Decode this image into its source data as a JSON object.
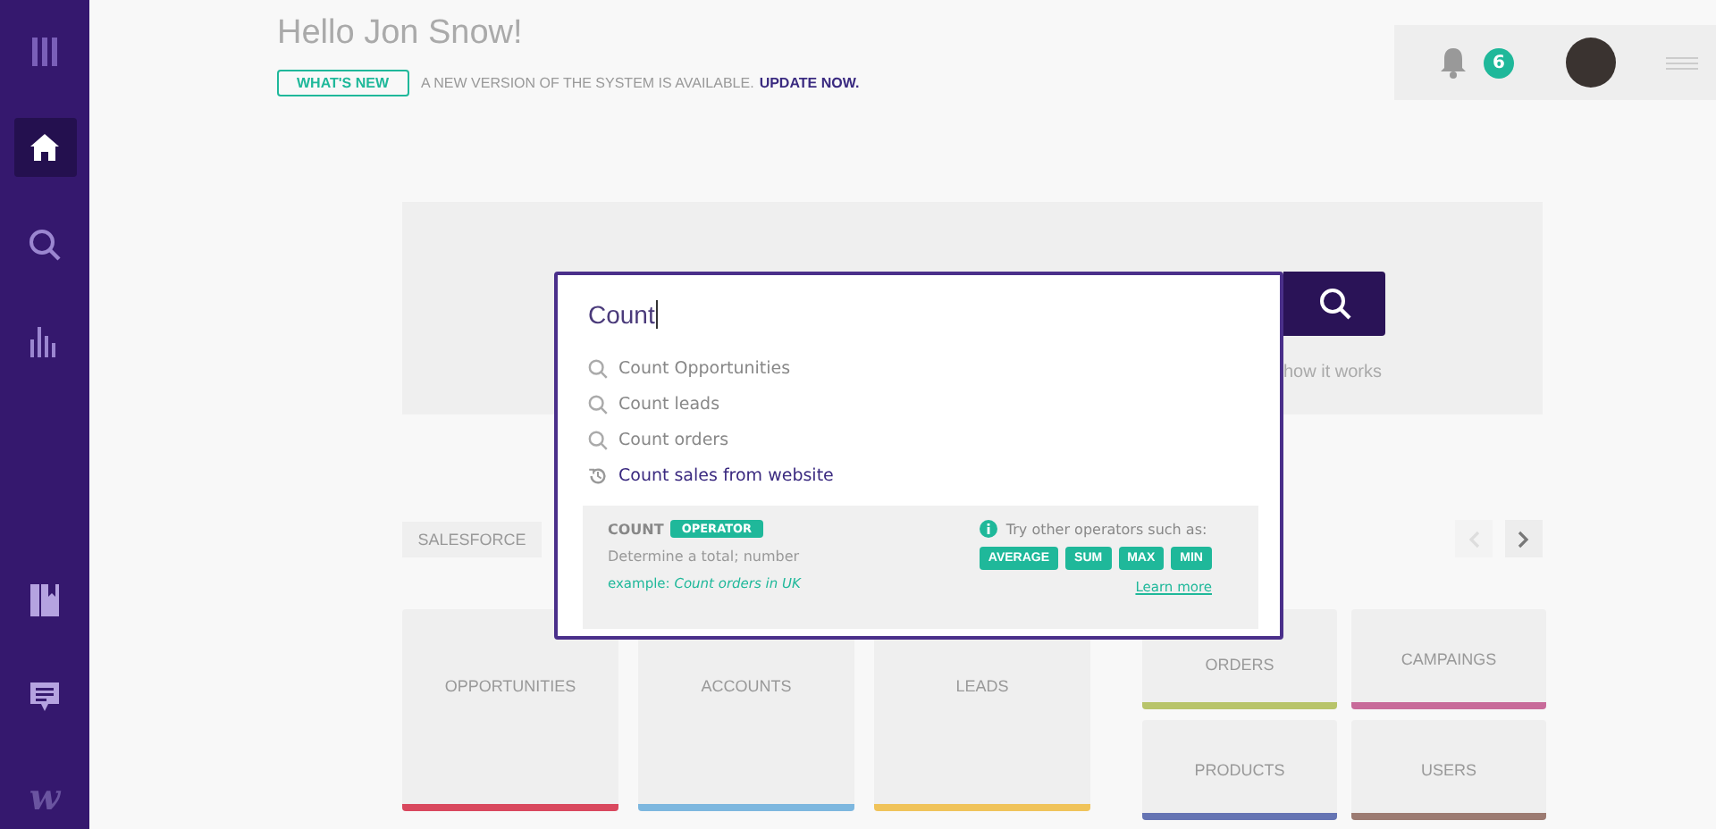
{
  "sidebar": {
    "items": [
      {
        "kind": "menu",
        "selected": false
      },
      {
        "kind": "home",
        "selected": true
      },
      {
        "kind": "search",
        "selected": false
      },
      {
        "kind": "chart",
        "selected": false
      },
      {
        "kind": "book",
        "selected": false
      },
      {
        "kind": "chat",
        "selected": false
      }
    ],
    "logo": "w"
  },
  "greeting": "Hello Jon Snow!",
  "announcement": {
    "badge": "WHAT'S NEW",
    "text": "A NEW VERSION OF THE SYSTEM IS AVAILABLE.",
    "link": "UPDATE NOW."
  },
  "topbar": {
    "notifications": "6"
  },
  "search": {
    "value": "Count",
    "help": "how it works",
    "suggestions": [
      {
        "text": "Count Opportunities",
        "kind": "search"
      },
      {
        "text": "Count leads",
        "kind": "search"
      },
      {
        "text": "Count orders",
        "kind": "search"
      },
      {
        "text": "Count sales from website",
        "kind": "history"
      }
    ],
    "operator": {
      "name": "COUNT",
      "tag": "OPERATOR",
      "description": "Determine a total; number",
      "example": "example: *Count orders in UK*",
      "hint": "Try other operators such as:",
      "operators": [
        "AVERAGE",
        "SUM",
        "MAX",
        "MIN"
      ],
      "learn_more": "Learn more"
    }
  },
  "tabs": [
    "SALESFORCE"
  ],
  "pager": {
    "prev_disabled": true,
    "next_disabled": false
  },
  "tiles": [
    {
      "label": "OPPORTUNITIES",
      "color": "#d9485e"
    },
    {
      "label": "ACCOUNTS",
      "color": "#7db7df"
    },
    {
      "label": "LEADS",
      "color": "#f0c35a"
    }
  ],
  "small_tiles": [
    {
      "label": "ORDERS",
      "color": "#b8c46a"
    },
    {
      "label": "CAMPAINGS",
      "color": "#c86b9a"
    },
    {
      "label": "PRODUCTS",
      "color": "#6574b3"
    },
    {
      "label": "USERS",
      "color": "#9c7b72"
    }
  ]
}
